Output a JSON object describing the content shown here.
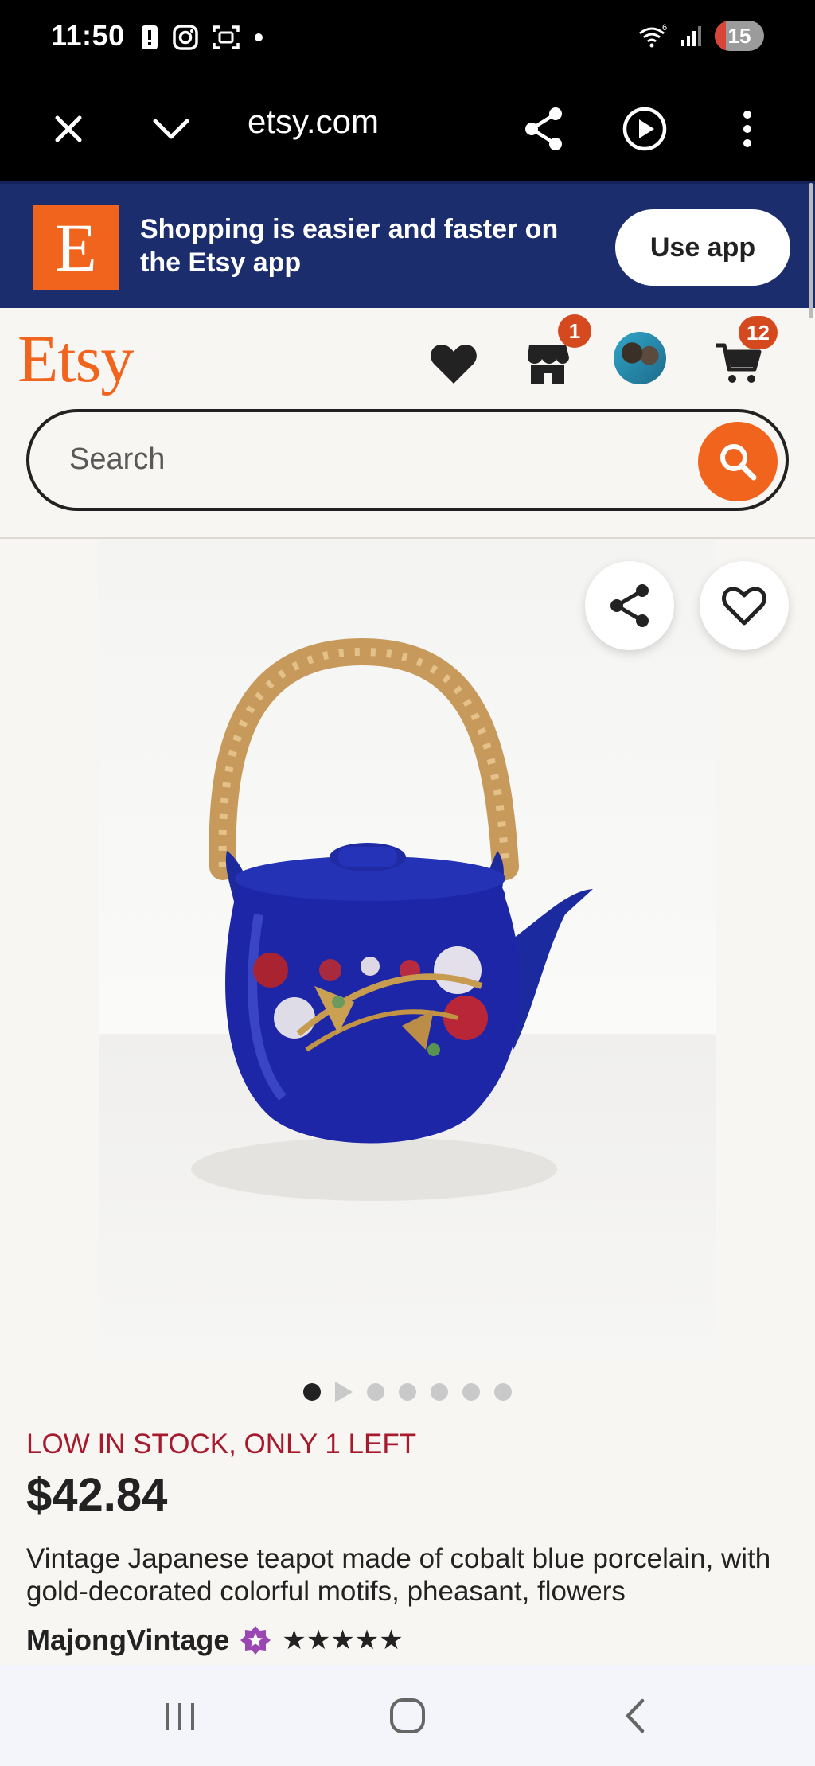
{
  "status_bar": {
    "time": "11:50",
    "battery_level": "15",
    "icons_left": [
      "alert-icon",
      "instagram-icon",
      "screenshot-icon",
      "dot-icon"
    ],
    "icons_right": [
      "wifi-icon",
      "signal-icon",
      "battery-icon"
    ]
  },
  "browser": {
    "url": "etsy.com",
    "buttons": [
      "close-icon",
      "chevron-down-icon",
      "share-icon",
      "play-icon",
      "more-icon"
    ]
  },
  "app_banner": {
    "logo_letter": "E",
    "message": "Shopping is easier and faster on the Etsy app",
    "button_label": "Use app",
    "background_color": "#1c2d6e",
    "accent_color": "#f1641e"
  },
  "header": {
    "logo_text": "Etsy",
    "shop_badge": "1",
    "cart_badge": "12",
    "search_placeholder": "Search"
  },
  "gallery": {
    "image_count": 7,
    "active_index": 0,
    "image_alt": "cobalt blue porcelain teapot with bamboo handle"
  },
  "listing": {
    "stock_notice": "LOW IN STOCK, ONLY 1 LEFT",
    "price": "$42.84",
    "title": "Vintage Japanese teapot made of cobalt blue porcelain, with gold-decorated colorful motifs, pheasant, flowers",
    "shop_name": "MajongVintage",
    "rating_stars": 5,
    "stars_text": "★★★★★"
  },
  "nav_bar": {
    "buttons": [
      "recent-apps-icon",
      "home-icon",
      "back-icon"
    ]
  }
}
